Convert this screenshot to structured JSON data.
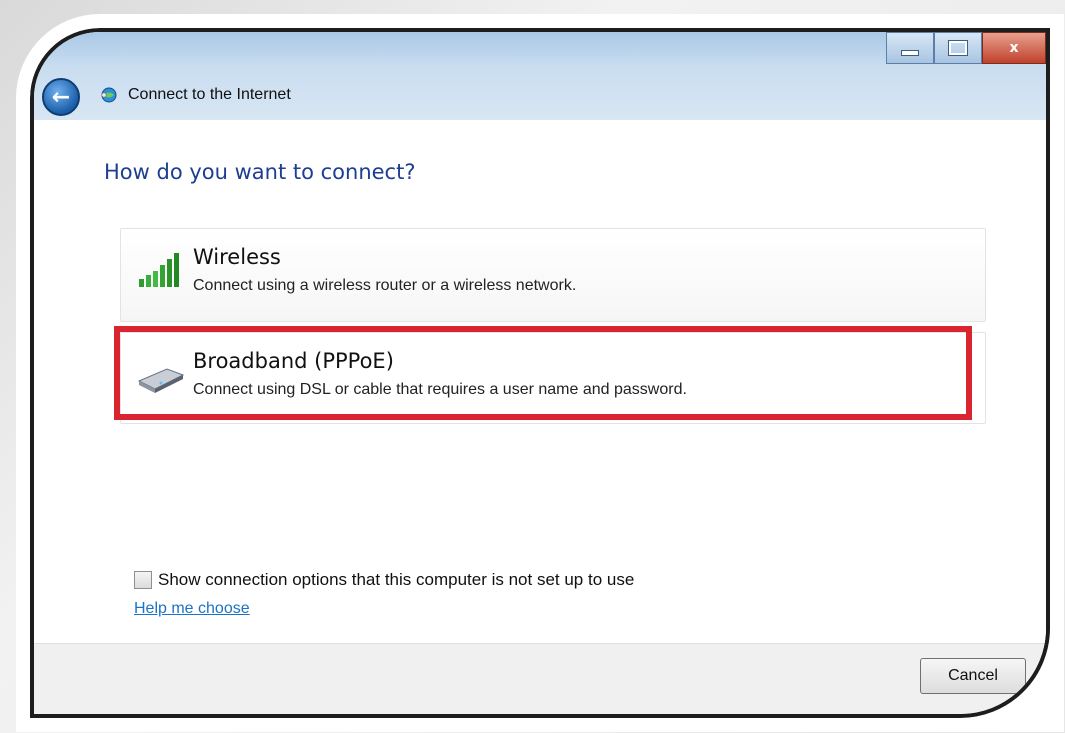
{
  "window": {
    "title": "Connect to the Internet",
    "close_glyph": "x"
  },
  "main": {
    "heading": "How do you want to connect?",
    "options": [
      {
        "title": "Wireless",
        "description": "Connect using a wireless router or a wireless network.",
        "icon": "wireless-signal-icon"
      },
      {
        "title": "Broadband (PPPoE)",
        "description": "Connect using DSL or cable that requires a user name and password.",
        "icon": "broadband-modem-icon",
        "highlighted": true
      }
    ],
    "checkbox_label": "Show connection options that this computer is not set up to use",
    "checkbox_checked": false,
    "help_link": "Help me choose"
  },
  "footer": {
    "cancel_label": "Cancel"
  },
  "colors": {
    "heading": "#1e3e91",
    "highlight": "#d9252f",
    "link": "#1a73c7"
  }
}
